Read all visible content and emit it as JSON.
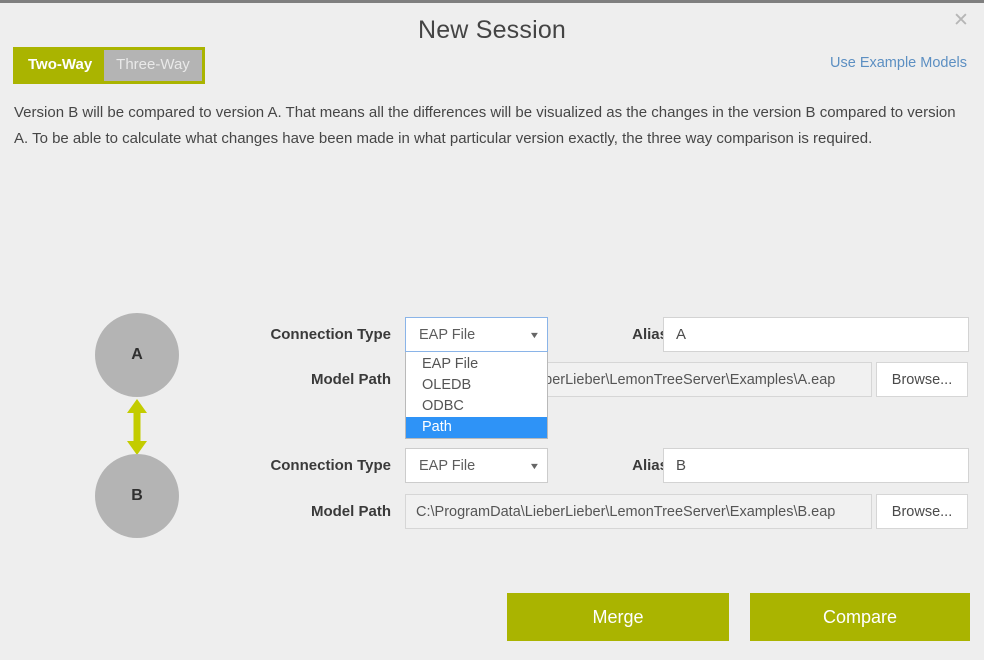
{
  "window": {
    "title": "New Session",
    "close_label": "✕"
  },
  "colors": {
    "accent": "#aab400",
    "node_gray": "#b4b4b4",
    "link_blue": "#5c8fc2",
    "highlight_blue": "#2e93f7",
    "background": "#eeeeee"
  },
  "mode_tabs": {
    "two_way": "Two-Way",
    "three_way": "Three-Way",
    "active": "Two-Way"
  },
  "example_link": {
    "label": "Use Example Models"
  },
  "description": {
    "text": "Version B will be compared to version A. That means all the differences will be visualized as the changes in the version B compared to version A. To be able to calculate what changes have been made in what particular version exactly, the three way comparison is required."
  },
  "graphic": {
    "node_a": "A",
    "node_b": "B"
  },
  "labels": {
    "connection_type": "Connection Type",
    "model_path": "Model Path",
    "alias": "Alias",
    "browse": "Browse..."
  },
  "version_a": {
    "connection_type_value": "EAP File",
    "alias_value": "A",
    "alias_placeholder": "A",
    "model_path_value": "C:\\ProgramData\\LieberLieber\\LemonTreeServer\\Examples\\A.eap",
    "model_path_visible": "eberLieber\\LemonTreeServer\\Examples\\A.eap",
    "browse_label": "Browse..."
  },
  "version_b": {
    "connection_type_value": "EAP File",
    "alias_value": "B",
    "alias_placeholder": "B",
    "model_path_value": "C:\\ProgramData\\LieberLieber\\LemonTreeServer\\Examples\\B.eap",
    "model_path_visible": "C:\\ProgramData\\LieberLieber\\LemonTreeServer\\Examples\\B.eap",
    "browse_label": "Browse..."
  },
  "connection_dropdown": {
    "open": true,
    "selected": "Path",
    "options": [
      {
        "label": "EAP File",
        "selected": false
      },
      {
        "label": "OLEDB",
        "selected": false
      },
      {
        "label": "ODBC",
        "selected": false
      },
      {
        "label": "Path",
        "selected": true
      }
    ]
  },
  "actions": {
    "merge": "Merge",
    "compare": "Compare"
  }
}
